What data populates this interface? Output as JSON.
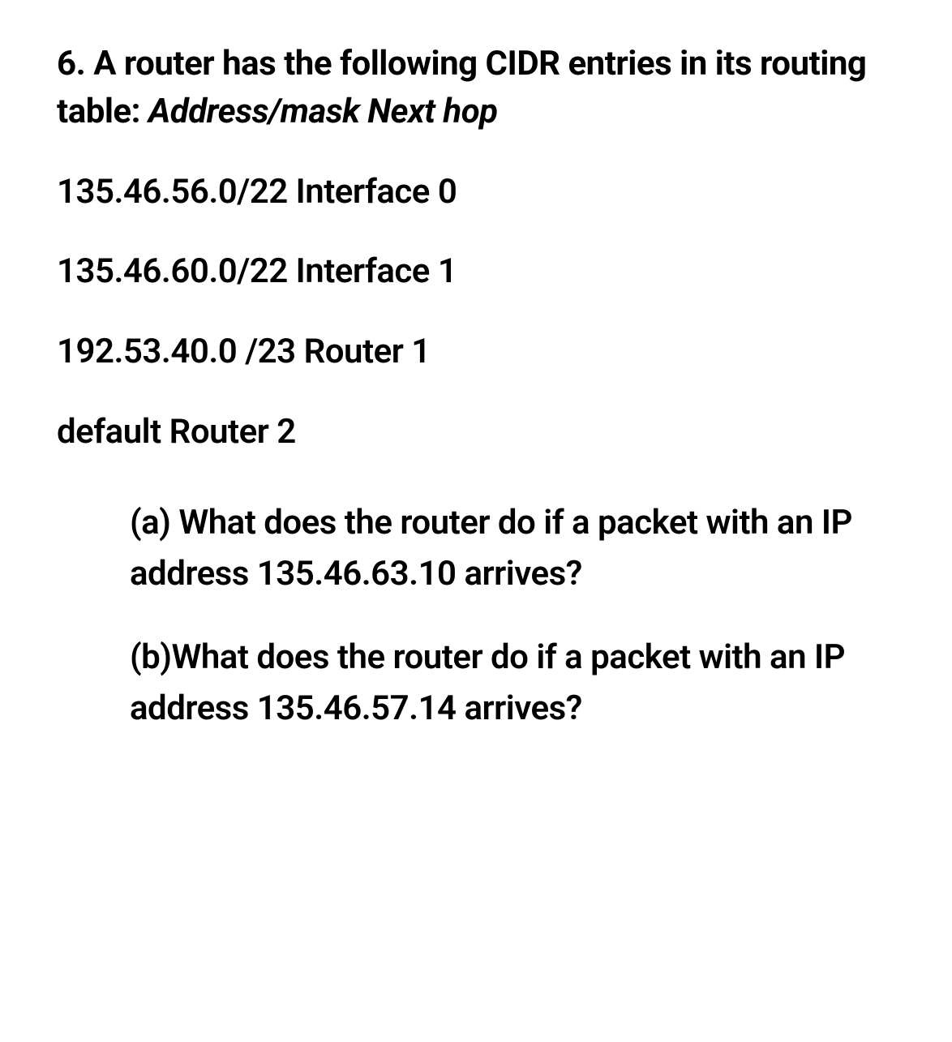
{
  "question": {
    "number": "6.",
    "intro_part1": "A router has the following CIDR entries in its routing table:",
    "intro_part2_italic": "Address/mask Next hop"
  },
  "routing_table": [
    "135.46.56.0/22 Interface 0",
    "135.46.60.0/22 Interface 1",
    "192.53.40.0 /23 Router 1",
    "default Router 2"
  ],
  "sub_questions": [
    "(a) What does the router do if a packet with an IP address 135.46.63.10 arrives?",
    "(b)What does the router do if a packet with an IP address 135.46.57.14 arrives?"
  ]
}
